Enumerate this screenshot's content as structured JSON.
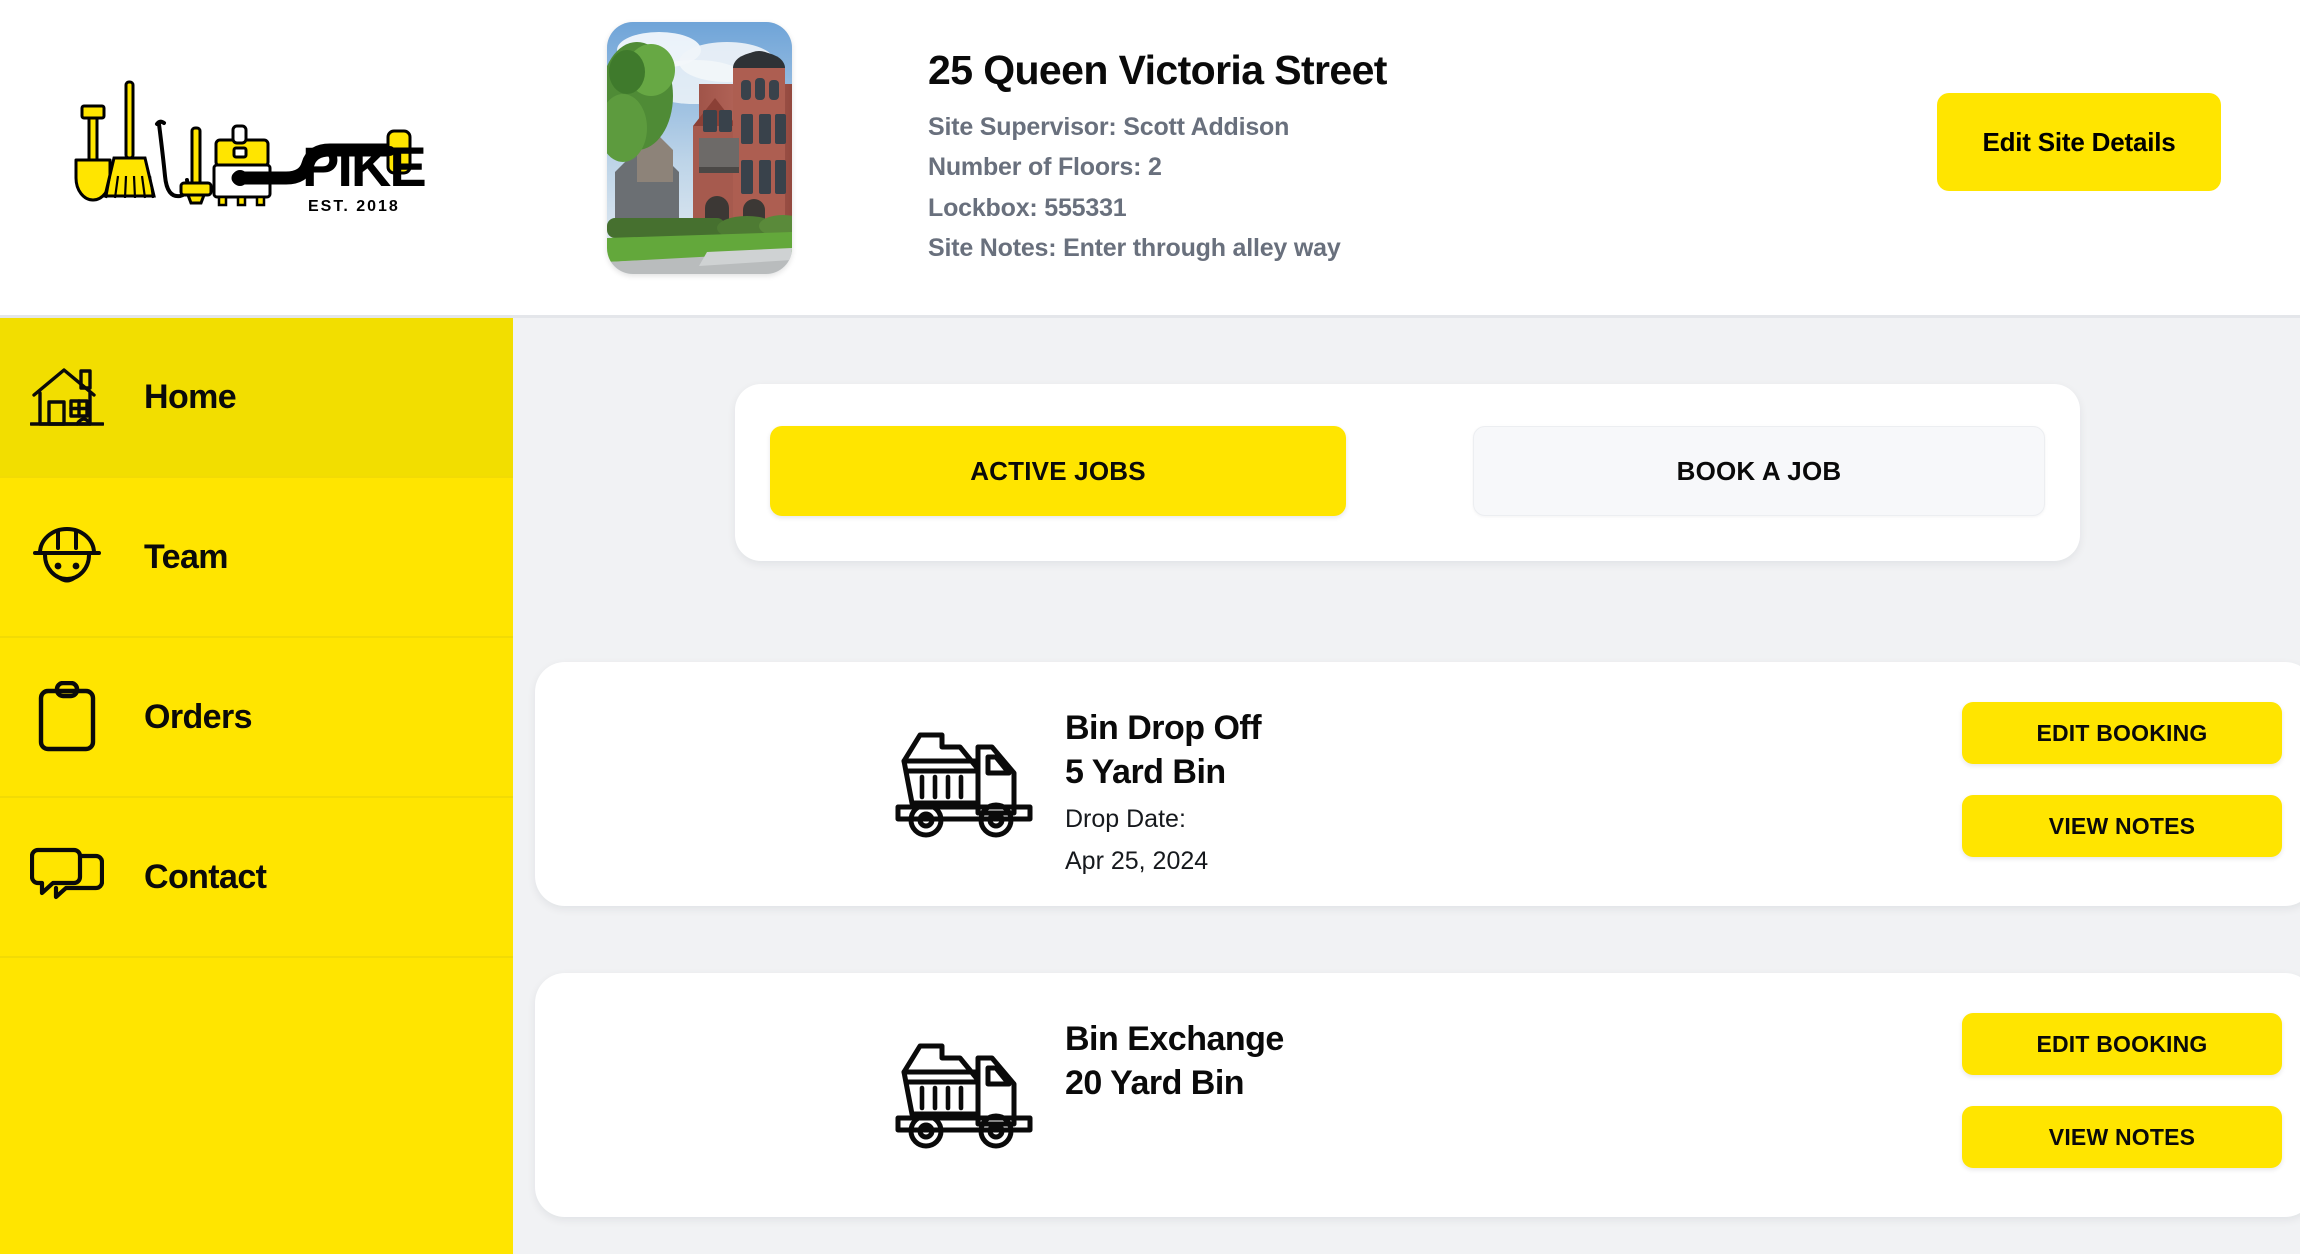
{
  "brand": {
    "name": "SPIKE",
    "established": "EST. 2018",
    "logo_icons": [
      "shovel-icon",
      "broom-icon",
      "hook-icon",
      "mop-icon",
      "vacuum-icon",
      "hose-nozzle-icon"
    ]
  },
  "header": {
    "site_photo_alt": "victorian-brick-house-photo",
    "title": "25 Queen Victoria Street",
    "details": [
      "Site Supervisor: Scott Addison",
      "Number of Floors: 2",
      "Lockbox: 555331",
      "Site Notes: Enter through alley way"
    ],
    "edit_button": "Edit Site Details"
  },
  "sidebar": {
    "items": [
      {
        "label": "Home",
        "icon": "house-icon",
        "active": true
      },
      {
        "label": "Team",
        "icon": "hard-hat-worker-icon",
        "active": false
      },
      {
        "label": "Orders",
        "icon": "clipboard-icon",
        "active": false
      },
      {
        "label": "Contact",
        "icon": "chat-bubbles-icon",
        "active": false
      }
    ]
  },
  "main": {
    "tabs": [
      {
        "label": "ACTIVE JOBS",
        "selected": true
      },
      {
        "label": "BOOK A JOB",
        "selected": false
      }
    ],
    "jobs": [
      {
        "icon": "dump-truck-icon",
        "title": "Bin Drop Off",
        "subtitle": "5 Yard Bin",
        "meta_label": "Drop Date:",
        "meta_value": "Apr 25, 2024",
        "edit_label": "EDIT BOOKING",
        "notes_label": "VIEW NOTES"
      },
      {
        "icon": "dump-truck-icon",
        "title": "Bin Exchange",
        "subtitle": "20 Yard Bin",
        "meta_label": "",
        "meta_value": "",
        "edit_label": "EDIT BOOKING",
        "notes_label": "VIEW NOTES"
      }
    ]
  },
  "colors": {
    "brand_yellow": "#FFE500",
    "active_nav_yellow": "#F2DE00",
    "content_bg": "#F1F2F4",
    "card_white": "#FFFFFF",
    "muted_text": "#69707D",
    "text_black": "#0A0A0A"
  }
}
